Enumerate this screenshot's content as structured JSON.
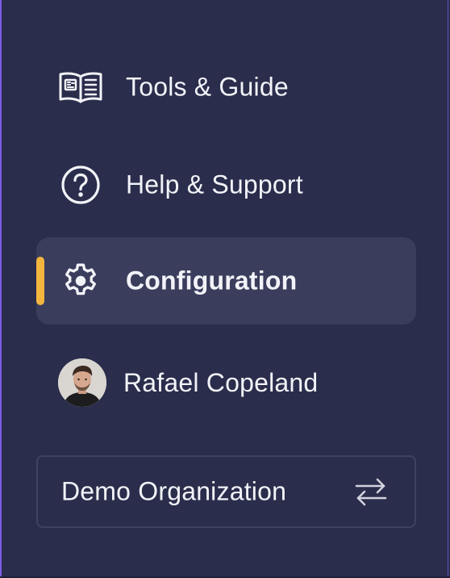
{
  "menu": {
    "items": [
      {
        "label": "Tools & Guide",
        "icon": "book-icon",
        "active": false
      },
      {
        "label": "Help & Support",
        "icon": "help-circle-icon",
        "active": false
      },
      {
        "label": "Configuration",
        "icon": "gear-icon",
        "active": true
      }
    ]
  },
  "user": {
    "name": "Rafael Copeland",
    "icon": "avatar"
  },
  "organization": {
    "name": "Demo Organization",
    "icon": "swap-arrows-icon"
  },
  "colors": {
    "background": "#2a2d4b",
    "active_item_background": "#3a3d5c",
    "active_indicator": "#f4b53f",
    "text": "#f2f3f8",
    "border": "#3f4262"
  }
}
